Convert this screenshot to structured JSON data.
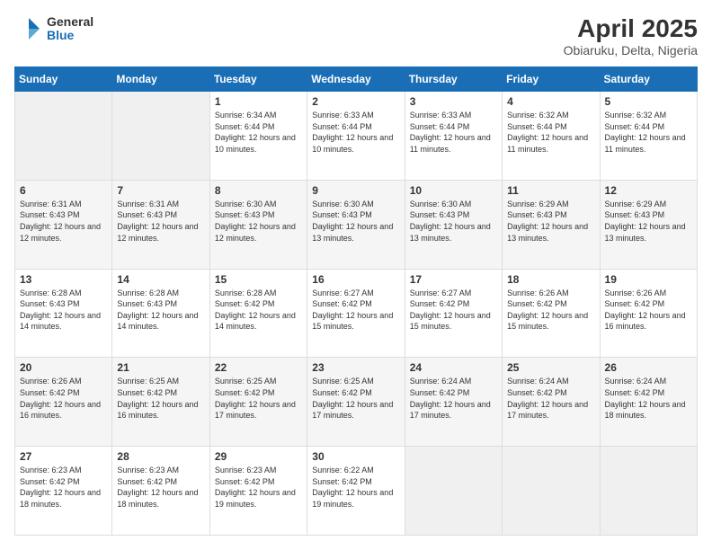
{
  "logo": {
    "general": "General",
    "blue": "Blue"
  },
  "header": {
    "title": "April 2025",
    "subtitle": "Obiaruku, Delta, Nigeria"
  },
  "weekdays": [
    "Sunday",
    "Monday",
    "Tuesday",
    "Wednesday",
    "Thursday",
    "Friday",
    "Saturday"
  ],
  "weeks": [
    [
      {
        "day": "",
        "empty": true
      },
      {
        "day": "",
        "empty": true
      },
      {
        "day": "1",
        "sunrise": "6:34 AM",
        "sunset": "6:44 PM",
        "daylight": "12 hours and 10 minutes."
      },
      {
        "day": "2",
        "sunrise": "6:33 AM",
        "sunset": "6:44 PM",
        "daylight": "12 hours and 10 minutes."
      },
      {
        "day": "3",
        "sunrise": "6:33 AM",
        "sunset": "6:44 PM",
        "daylight": "12 hours and 11 minutes."
      },
      {
        "day": "4",
        "sunrise": "6:32 AM",
        "sunset": "6:44 PM",
        "daylight": "12 hours and 11 minutes."
      },
      {
        "day": "5",
        "sunrise": "6:32 AM",
        "sunset": "6:44 PM",
        "daylight": "12 hours and 11 minutes."
      }
    ],
    [
      {
        "day": "6",
        "sunrise": "6:31 AM",
        "sunset": "6:43 PM",
        "daylight": "12 hours and 12 minutes."
      },
      {
        "day": "7",
        "sunrise": "6:31 AM",
        "sunset": "6:43 PM",
        "daylight": "12 hours and 12 minutes."
      },
      {
        "day": "8",
        "sunrise": "6:30 AM",
        "sunset": "6:43 PM",
        "daylight": "12 hours and 12 minutes."
      },
      {
        "day": "9",
        "sunrise": "6:30 AM",
        "sunset": "6:43 PM",
        "daylight": "12 hours and 13 minutes."
      },
      {
        "day": "10",
        "sunrise": "6:30 AM",
        "sunset": "6:43 PM",
        "daylight": "12 hours and 13 minutes."
      },
      {
        "day": "11",
        "sunrise": "6:29 AM",
        "sunset": "6:43 PM",
        "daylight": "12 hours and 13 minutes."
      },
      {
        "day": "12",
        "sunrise": "6:29 AM",
        "sunset": "6:43 PM",
        "daylight": "12 hours and 13 minutes."
      }
    ],
    [
      {
        "day": "13",
        "sunrise": "6:28 AM",
        "sunset": "6:43 PM",
        "daylight": "12 hours and 14 minutes."
      },
      {
        "day": "14",
        "sunrise": "6:28 AM",
        "sunset": "6:43 PM",
        "daylight": "12 hours and 14 minutes."
      },
      {
        "day": "15",
        "sunrise": "6:28 AM",
        "sunset": "6:42 PM",
        "daylight": "12 hours and 14 minutes."
      },
      {
        "day": "16",
        "sunrise": "6:27 AM",
        "sunset": "6:42 PM",
        "daylight": "12 hours and 15 minutes."
      },
      {
        "day": "17",
        "sunrise": "6:27 AM",
        "sunset": "6:42 PM",
        "daylight": "12 hours and 15 minutes."
      },
      {
        "day": "18",
        "sunrise": "6:26 AM",
        "sunset": "6:42 PM",
        "daylight": "12 hours and 15 minutes."
      },
      {
        "day": "19",
        "sunrise": "6:26 AM",
        "sunset": "6:42 PM",
        "daylight": "12 hours and 16 minutes."
      }
    ],
    [
      {
        "day": "20",
        "sunrise": "6:26 AM",
        "sunset": "6:42 PM",
        "daylight": "12 hours and 16 minutes."
      },
      {
        "day": "21",
        "sunrise": "6:25 AM",
        "sunset": "6:42 PM",
        "daylight": "12 hours and 16 minutes."
      },
      {
        "day": "22",
        "sunrise": "6:25 AM",
        "sunset": "6:42 PM",
        "daylight": "12 hours and 17 minutes."
      },
      {
        "day": "23",
        "sunrise": "6:25 AM",
        "sunset": "6:42 PM",
        "daylight": "12 hours and 17 minutes."
      },
      {
        "day": "24",
        "sunrise": "6:24 AM",
        "sunset": "6:42 PM",
        "daylight": "12 hours and 17 minutes."
      },
      {
        "day": "25",
        "sunrise": "6:24 AM",
        "sunset": "6:42 PM",
        "daylight": "12 hours and 17 minutes."
      },
      {
        "day": "26",
        "sunrise": "6:24 AM",
        "sunset": "6:42 PM",
        "daylight": "12 hours and 18 minutes."
      }
    ],
    [
      {
        "day": "27",
        "sunrise": "6:23 AM",
        "sunset": "6:42 PM",
        "daylight": "12 hours and 18 minutes."
      },
      {
        "day": "28",
        "sunrise": "6:23 AM",
        "sunset": "6:42 PM",
        "daylight": "12 hours and 18 minutes."
      },
      {
        "day": "29",
        "sunrise": "6:23 AM",
        "sunset": "6:42 PM",
        "daylight": "12 hours and 19 minutes."
      },
      {
        "day": "30",
        "sunrise": "6:22 AM",
        "sunset": "6:42 PM",
        "daylight": "12 hours and 19 minutes."
      },
      {
        "day": "",
        "empty": true
      },
      {
        "day": "",
        "empty": true
      },
      {
        "day": "",
        "empty": true
      }
    ]
  ],
  "labels": {
    "sunrise": "Sunrise:",
    "sunset": "Sunset:",
    "daylight": "Daylight:"
  }
}
